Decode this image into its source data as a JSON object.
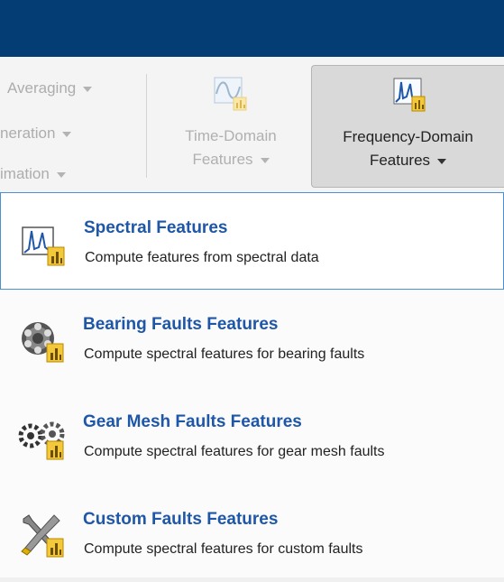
{
  "ribbon": {
    "left_items": [
      "Averaging",
      "neration",
      "imation"
    ],
    "time_domain": {
      "line1": "Time-Domain",
      "line2": "Features"
    },
    "freq_domain": {
      "line1": "Frequency-Domain",
      "line2": "Features"
    }
  },
  "menu": {
    "items": [
      {
        "title": "Spectral Features",
        "desc": "Compute features from spectral data",
        "icon": "spectral-icon"
      },
      {
        "title": "Bearing Faults Features",
        "desc": "Compute spectral features for bearing faults",
        "icon": "bearing-icon"
      },
      {
        "title": "Gear Mesh Faults Features",
        "desc": "Compute spectral features for gear mesh faults",
        "icon": "gear-icon"
      },
      {
        "title": "Custom Faults Features",
        "desc": "Compute spectral features for custom faults",
        "icon": "wrench-screwdriver-icon"
      }
    ]
  },
  "colors": {
    "titlebar": "#033d74",
    "link": "#1f57a8",
    "selection_border": "#4a90d2"
  }
}
